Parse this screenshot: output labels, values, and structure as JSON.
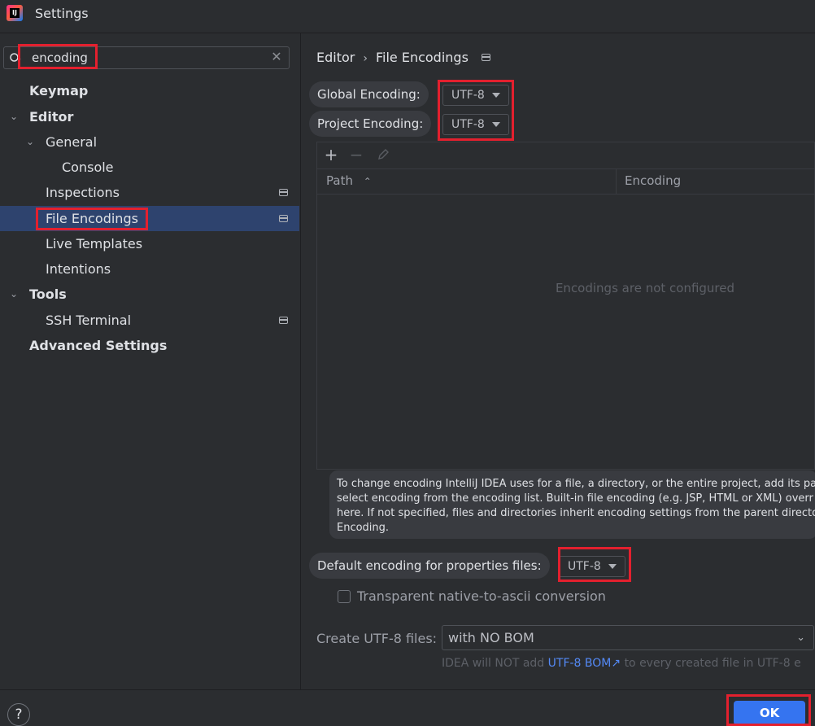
{
  "window": {
    "title": "Settings"
  },
  "search": {
    "value": "encoding"
  },
  "sidebar": {
    "items": [
      {
        "label": "Keymap"
      },
      {
        "label": "Editor"
      },
      {
        "label": "General"
      },
      {
        "label": "Console"
      },
      {
        "label": "Inspections"
      },
      {
        "label": "File Encodings"
      },
      {
        "label": "Live Templates"
      },
      {
        "label": "Intentions"
      },
      {
        "label": "Tools"
      },
      {
        "label": "SSH Terminal"
      },
      {
        "label": "Advanced Settings"
      }
    ]
  },
  "main": {
    "breadcrumb": [
      "Editor",
      "File Encodings"
    ],
    "global_encoding": {
      "label": "Global Encoding:",
      "value": "UTF-8"
    },
    "project_encoding": {
      "label": "Project Encoding:",
      "value": "UTF-8"
    },
    "table": {
      "columns": [
        "Path",
        "Encoding"
      ],
      "empty_text": "Encodings are not configured"
    },
    "info_lines": [
      "To change encoding IntelliJ IDEA uses for a file, a directory, or the entire project, add its pa",
      "select encoding from the encoding list. Built-in file encoding (e.g. JSP, HTML or XML) overr",
      "here. If not specified, files and directories inherit encoding settings from the parent directo",
      "Encoding."
    ],
    "properties_encoding": {
      "label": "Default encoding for properties files:",
      "value": "UTF-8"
    },
    "transparent_checkbox": {
      "label": "Transparent native-to-ascii conversion",
      "checked": false
    },
    "create_utf8": {
      "label": "Create UTF-8 files:",
      "value": "with NO BOM"
    },
    "hint": {
      "prefix": "IDEA will NOT add",
      "link": "UTF-8 BOM",
      "suffix": "to every created file in UTF-8 e"
    }
  },
  "footer": {
    "ok_label": "OK",
    "help_label": "?"
  },
  "colors": {
    "accent": "#3574f0",
    "highlight_box": "#e3202e",
    "selection": "#2e436e"
  }
}
